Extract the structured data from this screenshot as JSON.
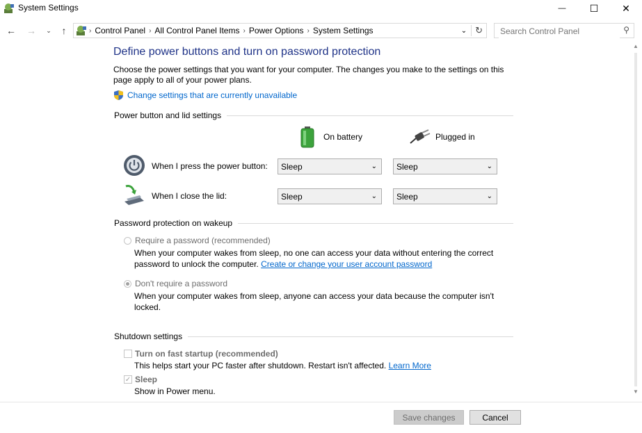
{
  "window": {
    "title": "System Settings",
    "minimize_glyph": "—",
    "maximize_glyph": "☐",
    "close_glyph": "✕"
  },
  "address": {
    "crumbs": [
      "Control Panel",
      "All Control Panel Items",
      "Power Options",
      "System Settings"
    ],
    "search_placeholder": "Search Control Panel"
  },
  "page": {
    "heading": "Define power buttons and turn on password protection",
    "description": "Choose the power settings that you want for your computer. The changes you make to the settings on this page apply to all of your power plans.",
    "change_link": "Change settings that are currently unavailable"
  },
  "power_section": {
    "title": "Power button and lid settings",
    "col_battery": "On battery",
    "col_plugged": "Plugged in",
    "rows": [
      {
        "label": "When I press the power button:",
        "battery": "Sleep",
        "plugged": "Sleep"
      },
      {
        "label": "When I close the lid:",
        "battery": "Sleep",
        "plugged": "Sleep"
      }
    ]
  },
  "password_section": {
    "title": "Password protection on wakeup",
    "require_label": "Require a password (recommended)",
    "require_desc": "When your computer wakes from sleep, no one can access your data without entering the correct password to unlock the computer.",
    "require_link": "Create or change your user account password",
    "norequire_label": "Don't require a password",
    "norequire_desc": "When your computer wakes from sleep, anyone can access your data because the computer isn't locked."
  },
  "shutdown_section": {
    "title": "Shutdown settings",
    "fast_startup_label": "Turn on fast startup (recommended)",
    "fast_startup_desc": "This helps start your PC faster after shutdown. Restart isn't affected.",
    "learn_more": "Learn More",
    "sleep_label": "Sleep",
    "sleep_desc": "Show in Power menu."
  },
  "buttons": {
    "save": "Save changes",
    "cancel": "Cancel"
  },
  "colors": {
    "heading": "#1e3287",
    "link": "#0066cc",
    "battery_green": "#3ca33c"
  }
}
